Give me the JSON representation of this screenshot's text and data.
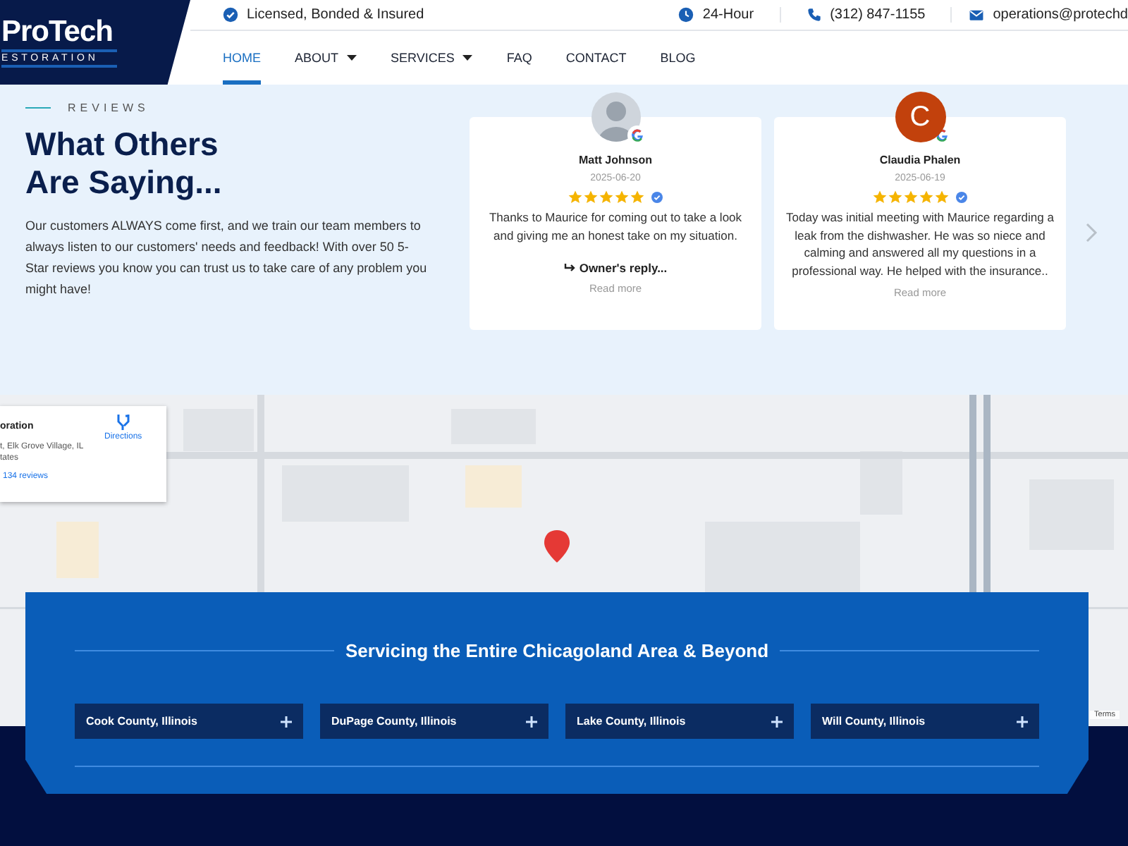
{
  "logo": {
    "name": "ProTech",
    "tagline": "ESTORATION"
  },
  "top_bar": [
    {
      "kind": "check",
      "text": "Licensed, Bonded & Insured"
    },
    {
      "kind": "clock",
      "text": "24-Hour"
    },
    {
      "kind": "phone",
      "text": "(312) 847-1155"
    },
    {
      "kind": "mail",
      "text": "operations@protechd"
    }
  ],
  "nav": [
    {
      "label": "HOME",
      "selected": true,
      "has_menu": false
    },
    {
      "label": "ABOUT",
      "selected": false,
      "has_menu": true
    },
    {
      "label": "SERVICES",
      "selected": false,
      "has_menu": true
    },
    {
      "label": "FAQ",
      "selected": false,
      "has_menu": false
    },
    {
      "label": "CONTACT",
      "selected": false,
      "has_menu": false
    },
    {
      "label": "BLOG",
      "selected": false,
      "has_menu": false
    }
  ],
  "reviews": {
    "eyebrow": "REVIEWS",
    "heading": "What Others Are Saying...",
    "intro": "Our customers ALWAYS come first, and we train our team members to always listen to our customers' needs and feedback! With over 50 5-Star reviews you know you can trust us to take care of any problem you might have!",
    "cards": [
      {
        "avatar": {
          "kind": "photo"
        },
        "name": "Matt Johnson",
        "date": "2025-06-20",
        "stars": 5,
        "verified": true,
        "text": "Thanks to Maurice for coming out to take a look and giving me an honest take on my situation.",
        "owner_reply": "Owner's reply...",
        "read_more": "Read more"
      },
      {
        "avatar": {
          "kind": "letter",
          "letter": "C"
        },
        "name": "Claudia Phalen",
        "date": "2025-06-19",
        "stars": 5,
        "verified": true,
        "text": "Today was initial meeting with Maurice regarding a leak from the dishwasher. He was so niece and calming and answered all my questions in a professional way. He helped with the insurance..",
        "read_more": "Read more"
      }
    ]
  },
  "map": {
    "place_card": {
      "title": "oration",
      "address": [
        "t, Elk Grove Village, IL",
        "tates"
      ],
      "reviews": "134 reviews",
      "directions": "Directions"
    },
    "terms": "Terms"
  },
  "service_area": {
    "title": "Servicing the Entire Chicagoland Area & Beyond",
    "counties": [
      {
        "label": "Cook County, Illinois",
        "expanded": false
      },
      {
        "label": "DuPage County, Illinois",
        "expanded": false
      },
      {
        "label": "Lake County, Illinois",
        "expanded": false
      },
      {
        "label": "Will County, Illinois",
        "expanded": false
      }
    ]
  }
}
